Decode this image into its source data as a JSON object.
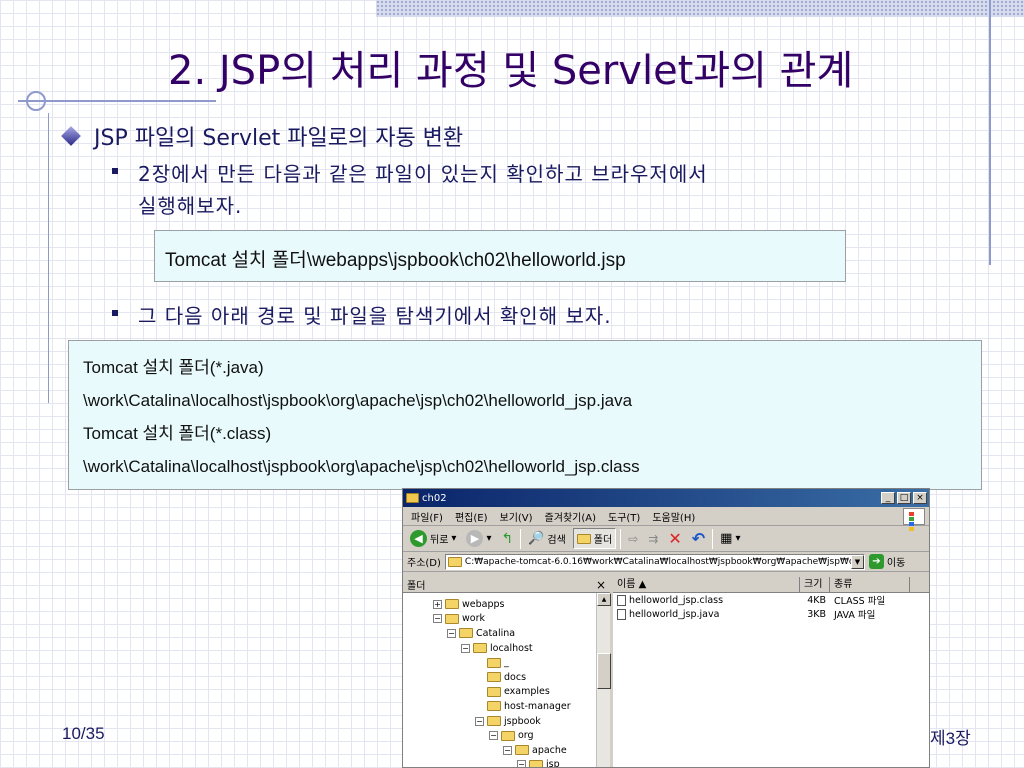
{
  "slide": {
    "title": "2. JSP의 처리 과정 및 Servlet과의 관계",
    "bullet_main": "JSP 파일의 Servlet 파일로의 자동 변환",
    "sub1_line1": "2장에서 만든 다음과 같은 파일이 있는지 확인하고 브라우저에서",
    "sub1_line2": "실행해보자.",
    "box1": "Tomcat 설치 폴더\\webapps\\jspbook\\ch02\\helloworld.jsp",
    "sub2": "그 다음 아래 경로 및 파일을 탐색기에서 확인해 보자.",
    "box2_lines": [
      "Tomcat 설치 폴더(*.java)",
      "\\work\\Catalina\\localhost\\jspbook\\org\\apache\\jsp\\ch02\\helloworld_jsp.java",
      "Tomcat 설치 폴더(*.class)",
      "\\work\\Catalina\\localhost\\jspbook\\org\\apache\\jsp\\ch02\\helloworld_jsp.class"
    ],
    "page_number": "10/35",
    "chapter": "제3장"
  },
  "explorer": {
    "title": "ch02",
    "menu": [
      "파일(F)",
      "편집(E)",
      "보기(V)",
      "즐겨찾기(A)",
      "도구(T)",
      "도움말(H)"
    ],
    "toolbar": {
      "back": "뒤로",
      "search": "검색",
      "folders": "폴더"
    },
    "address_label": "주소(D)",
    "address_value": "C:₩apache-tomcat-6.0.16₩work₩Catalina₩localhost₩jspbook₩org₩apache₩jsp₩ch02",
    "go_label": "이동",
    "folder_pane_title": "폴더",
    "close_glyph": "×",
    "tree": [
      {
        "label": "webapps",
        "expander": "+",
        "indent": 0
      },
      {
        "label": "work",
        "expander": "−",
        "indent": 0
      },
      {
        "label": "Catalina",
        "expander": "−",
        "indent": 1
      },
      {
        "label": "localhost",
        "expander": "−",
        "indent": 2
      },
      {
        "label": "_",
        "expander": "",
        "indent": 3
      },
      {
        "label": "docs",
        "expander": "",
        "indent": 3
      },
      {
        "label": "examples",
        "expander": "",
        "indent": 3
      },
      {
        "label": "host-manager",
        "expander": "",
        "indent": 3
      },
      {
        "label": "jspbook",
        "expander": "−",
        "indent": 3
      },
      {
        "label": "org",
        "expander": "−",
        "indent": 4
      },
      {
        "label": "apache",
        "expander": "−",
        "indent": 5
      },
      {
        "label": "jsp",
        "expander": "−",
        "indent": 6
      }
    ],
    "columns": {
      "name": "이름 ▲",
      "size": "크기",
      "type": "종류"
    },
    "files": [
      {
        "name": "helloworld_jsp.class",
        "size": "4KB",
        "type": "CLASS 파일"
      },
      {
        "name": "helloworld_jsp.java",
        "size": "3KB",
        "type": "JAVA 파일"
      }
    ],
    "colors": {
      "title_start": "#0a246a",
      "title_end": "#3a6ea5",
      "folder": "#f4d466",
      "face": "#d4d0c8"
    }
  }
}
